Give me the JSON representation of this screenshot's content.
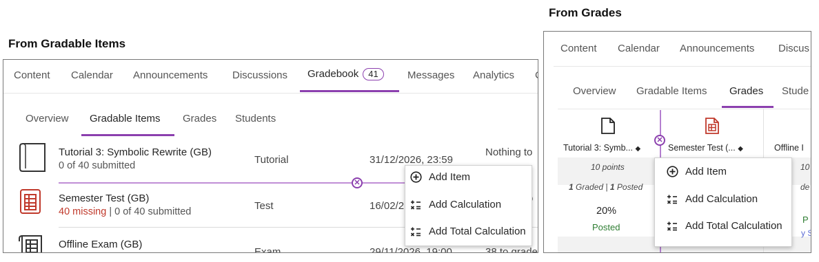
{
  "left": {
    "heading": "From Gradable Items",
    "nav": [
      "Content",
      "Calendar",
      "Announcements",
      "Discussions",
      "Gradebook",
      "Messages",
      "Analytics",
      "C"
    ],
    "gradebook_count": "41",
    "subtabs": [
      "Overview",
      "Gradable Items",
      "Grades",
      "Students"
    ],
    "rows": [
      {
        "title": "Tutorial 3: Symbolic Rewrite (GB)",
        "missing": "",
        "submitted": "0 of 40 submitted",
        "category": "Tutorial",
        "due": "31/12/2026, 23:59",
        "status": "Nothing to"
      },
      {
        "title": "Semester Test (GB)",
        "missing": "40 missing",
        "submitted": "| 0 of 40 submitted",
        "category": "Test",
        "due": "16/02/2",
        "status": "o"
      },
      {
        "title": "Offline Exam (GB)",
        "missing": "",
        "submitted": "",
        "category": "Exam",
        "due": "29/11/2026, 19:00",
        "status": "38 to grade"
      }
    ],
    "menu": [
      "Add Item",
      "Add Calculation",
      "Add Total Calculation"
    ]
  },
  "right": {
    "heading": "From Grades",
    "nav": [
      "Content",
      "Calendar",
      "Announcements",
      "Discus"
    ],
    "subtabs": [
      "Overview",
      "Gradable Items",
      "Grades",
      "Stude"
    ],
    "columns": [
      "Tutorial 3: Symb...",
      "Semester Test (...",
      "Offline I"
    ],
    "points": "10 points",
    "points_partial": "10",
    "graded_count": "1",
    "graded_label": "Graded |",
    "posted_count": "1",
    "posted_label": "Posted",
    "partial_de": "de",
    "grade_value": "20%",
    "grade_status": "Posted",
    "partial_p": "P",
    "partial_s": "y S",
    "menu": [
      "Add Item",
      "Add Calculation",
      "Add Total Calculation"
    ]
  },
  "colors": {
    "accent": "#8b3fae",
    "missing": "#c0392b",
    "posted": "#2e7d32"
  }
}
